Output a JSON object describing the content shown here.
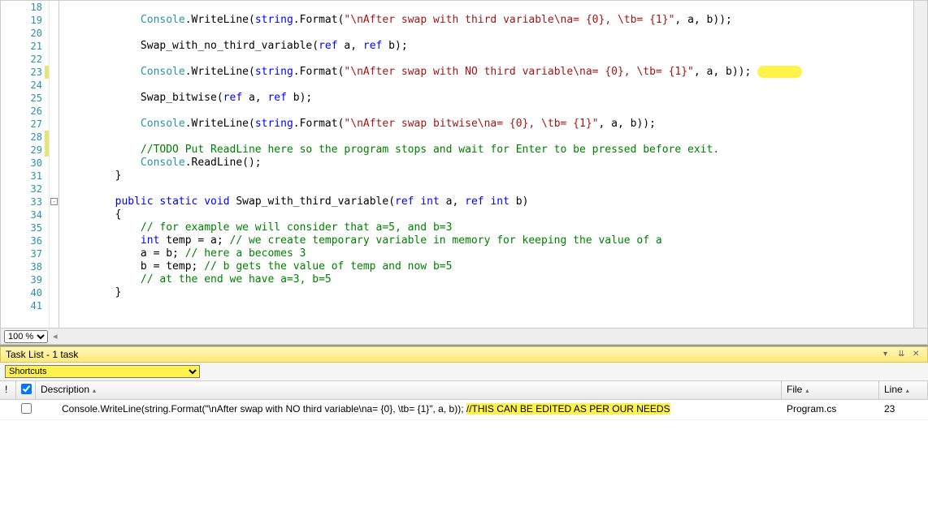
{
  "editor": {
    "zoom": "100 %",
    "lines": [
      {
        "n": 18,
        "code": ""
      },
      {
        "n": 19,
        "code": "            Console.WriteLine(string.Format(\"\\nAfter swap with third variable\\na= {0}, \\tb= {1}\", a, b));",
        "tokens": [
          [
            "            ",
            "p"
          ],
          [
            "Console",
            "type"
          ],
          [
            ".",
            "p"
          ],
          [
            "WriteLine",
            "ident"
          ],
          [
            "(",
            "p"
          ],
          [
            "string",
            "kw"
          ],
          [
            ".",
            "p"
          ],
          [
            "Format",
            "ident"
          ],
          [
            "(",
            "p"
          ],
          [
            "\"\\nAfter swap with third variable\\na= {0}, \\tb= {1}\"",
            "str"
          ],
          [
            ", a, b));",
            "p"
          ]
        ]
      },
      {
        "n": 20,
        "code": ""
      },
      {
        "n": 21,
        "code": "            Swap_with_no_third_variable(ref a, ref b);",
        "tokens": [
          [
            "            Swap_with_no_third_variable(",
            "p"
          ],
          [
            "ref",
            "kw"
          ],
          [
            " a, ",
            "p"
          ],
          [
            "ref",
            "kw"
          ],
          [
            " b);",
            "p"
          ]
        ]
      },
      {
        "n": 22,
        "code": "",
        "bookmark": true
      },
      {
        "n": 23,
        "code": "            Console.WriteLine(string.Format(\"\\nAfter swap with NO third variable\\na= {0}, \\tb= {1}\", a, b));",
        "tokens": [
          [
            "            ",
            "p"
          ],
          [
            "Console",
            "type"
          ],
          [
            ".",
            "p"
          ],
          [
            "WriteLine",
            "ident"
          ],
          [
            "(",
            "p"
          ],
          [
            "string",
            "kw"
          ],
          [
            ".",
            "p"
          ],
          [
            "Format",
            "ident"
          ],
          [
            "(",
            "p"
          ],
          [
            "\"\\nAfter swap with NO third variable\\na= {0}, \\tb= {1}\"",
            "str"
          ],
          [
            ", a, b));",
            "p"
          ]
        ],
        "changed": true,
        "tailHighlight": true
      },
      {
        "n": 24,
        "code": ""
      },
      {
        "n": 25,
        "code": "            Swap_bitwise(ref a, ref b);",
        "tokens": [
          [
            "            Swap_bitwise(",
            "p"
          ],
          [
            "ref",
            "kw"
          ],
          [
            " a, ",
            "p"
          ],
          [
            "ref",
            "kw"
          ],
          [
            " b);",
            "p"
          ]
        ]
      },
      {
        "n": 26,
        "code": ""
      },
      {
        "n": 27,
        "code": "            Console.WriteLine(string.Format(\"\\nAfter swap bitwise\\na= {0}, \\tb= {1}\", a, b));",
        "tokens": [
          [
            "            ",
            "p"
          ],
          [
            "Console",
            "type"
          ],
          [
            ".",
            "p"
          ],
          [
            "WriteLine",
            "ident"
          ],
          [
            "(",
            "p"
          ],
          [
            "string",
            "kw"
          ],
          [
            ".",
            "p"
          ],
          [
            "Format",
            "ident"
          ],
          [
            "(",
            "p"
          ],
          [
            "\"\\nAfter swap bitwise\\na= {0}, \\tb= {1}\"",
            "str"
          ],
          [
            ", a, b));",
            "p"
          ]
        ]
      },
      {
        "n": 28,
        "code": "",
        "changed": true
      },
      {
        "n": 29,
        "code": "            //TODO Put ReadLine here so the program stops and wait for Enter to be pressed before exit.",
        "tokens": [
          [
            "            ",
            "p"
          ],
          [
            "//TODO Put ReadLine here so the program stops and wait for Enter to be pressed before exit.",
            "cmt"
          ]
        ],
        "changed": true
      },
      {
        "n": 30,
        "code": "            Console.ReadLine();",
        "tokens": [
          [
            "            ",
            "p"
          ],
          [
            "Console",
            "type"
          ],
          [
            ".ReadLine();",
            "p"
          ]
        ]
      },
      {
        "n": 31,
        "code": "        }",
        "tokens": [
          [
            "        }",
            "p"
          ]
        ]
      },
      {
        "n": 32,
        "code": ""
      },
      {
        "n": 33,
        "code": "        public static void Swap_with_third_variable(ref int a, ref int b)",
        "tokens": [
          [
            "        ",
            "p"
          ],
          [
            "public",
            "kw"
          ],
          [
            " ",
            "p"
          ],
          [
            "static",
            "kw"
          ],
          [
            " ",
            "p"
          ],
          [
            "void",
            "kw"
          ],
          [
            " Swap_with_third_variable(",
            "p"
          ],
          [
            "ref",
            "kw"
          ],
          [
            " ",
            "p"
          ],
          [
            "int",
            "kw"
          ],
          [
            " a, ",
            "p"
          ],
          [
            "ref",
            "kw"
          ],
          [
            " ",
            "p"
          ],
          [
            "int",
            "kw"
          ],
          [
            " b)",
            "p"
          ]
        ],
        "outline": true
      },
      {
        "n": 34,
        "code": "        {",
        "tokens": [
          [
            "        {",
            "p"
          ]
        ]
      },
      {
        "n": 35,
        "code": "            // for example we will consider that a=5, and b=3",
        "tokens": [
          [
            "            ",
            "p"
          ],
          [
            "// for example we will consider that a=5, and b=3",
            "cmt"
          ]
        ]
      },
      {
        "n": 36,
        "code": "            int temp = a; // we create temporary variable in memory for keeping the value of a",
        "tokens": [
          [
            "            ",
            "p"
          ],
          [
            "int",
            "kw"
          ],
          [
            " temp = a; ",
            "p"
          ],
          [
            "// we create temporary variable in memory for keeping the value of a",
            "cmt"
          ]
        ]
      },
      {
        "n": 37,
        "code": "            a = b; // here a becomes 3",
        "tokens": [
          [
            "            a = b; ",
            "p"
          ],
          [
            "// here a becomes 3",
            "cmt"
          ]
        ]
      },
      {
        "n": 38,
        "code": "            b = temp; // b gets the value of temp and now b=5",
        "tokens": [
          [
            "            b = temp; ",
            "p"
          ],
          [
            "// b gets the value of temp and now b=5",
            "cmt"
          ]
        ]
      },
      {
        "n": 39,
        "code": "            // at the end we have a=3, b=5",
        "tokens": [
          [
            "            ",
            "p"
          ],
          [
            "// at the end we have a=3, b=5",
            "cmt"
          ]
        ]
      },
      {
        "n": 40,
        "code": "        }",
        "tokens": [
          [
            "        }",
            "p"
          ]
        ]
      },
      {
        "n": 41,
        "code": ""
      }
    ]
  },
  "tasklist": {
    "title": "Task List - 1 task",
    "filter": "Shortcuts",
    "columns": {
      "priority": "!",
      "desc": "Description",
      "file": "File",
      "line": "Line"
    },
    "rows": [
      {
        "desc_plain": "Console.WriteLine(string.Format(\"\\nAfter swap with NO third variable\\na= {0}, \\tb= {1}\", a, b)); ",
        "desc_hl": "//THIS CAN BE EDITED AS PER OUR NEEDS",
        "file": "Program.cs",
        "line": "23"
      }
    ]
  }
}
